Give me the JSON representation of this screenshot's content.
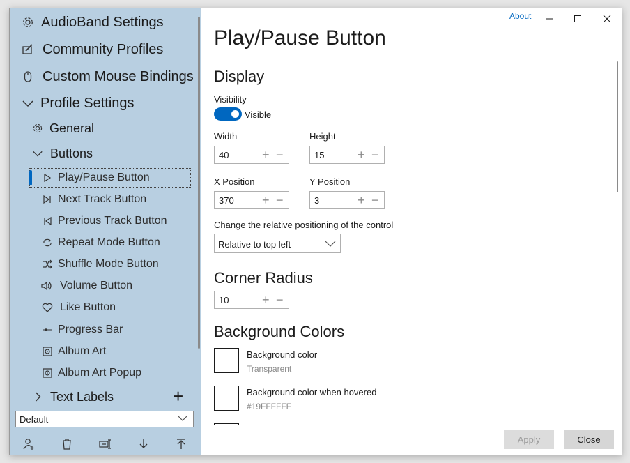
{
  "sidebar": {
    "items": [
      {
        "label": "AudioBand Settings",
        "icon": "gear-icon"
      },
      {
        "label": "Community Profiles",
        "icon": "edit-icon"
      },
      {
        "label": "Custom Mouse Bindings",
        "icon": "mouse-icon"
      },
      {
        "label": "Profile Settings",
        "icon": "chevron-down-icon"
      },
      {
        "label": "General",
        "icon": "gear-icon"
      },
      {
        "label": "Buttons",
        "icon": "chevron-down-icon"
      },
      {
        "label": "Play/Pause Button",
        "icon": "play-icon"
      },
      {
        "label": "Next Track Button",
        "icon": "next-track-icon"
      },
      {
        "label": "Previous Track Button",
        "icon": "previous-track-icon"
      },
      {
        "label": "Repeat Mode Button",
        "icon": "repeat-icon"
      },
      {
        "label": "Shuffle Mode Button",
        "icon": "shuffle-icon"
      },
      {
        "label": "Volume Button",
        "icon": "volume-icon"
      },
      {
        "label": "Like Button",
        "icon": "heart-icon"
      },
      {
        "label": "Progress Bar",
        "icon": "progress-icon"
      },
      {
        "label": "Album Art",
        "icon": "album-icon"
      },
      {
        "label": "Album Art Popup",
        "icon": "album-icon"
      },
      {
        "label": "Text Labels",
        "icon": "chevron-right-icon"
      }
    ],
    "add_glyph": "+",
    "profile_select": {
      "value": "Default"
    }
  },
  "titlebar": {
    "about": "About"
  },
  "main": {
    "title": "Play/Pause Button",
    "display": {
      "heading": "Display",
      "visibility_label": "Visibility",
      "visibility_value": "Visible",
      "width_label": "Width",
      "width_value": "40",
      "height_label": "Height",
      "height_value": "15",
      "x_label": "X Position",
      "x_value": "370",
      "y_label": "Y Position",
      "y_value": "3",
      "relative_label": "Change the relative positioning of the control",
      "relative_value": "Relative to top left"
    },
    "corner_radius": {
      "heading": "Corner Radius",
      "value": "10"
    },
    "background_colors": {
      "heading": "Background Colors",
      "items": [
        {
          "label": "Background color",
          "value": "Transparent"
        },
        {
          "label": "Background color when hovered",
          "value": "#19FFFFFF"
        }
      ]
    },
    "stepper": {
      "plus": "+",
      "minus": "−"
    }
  },
  "footer": {
    "apply": "Apply",
    "close": "Close"
  },
  "colors": {
    "accent": "#0067c0",
    "sidebar_bg": "#b8cfe1"
  }
}
